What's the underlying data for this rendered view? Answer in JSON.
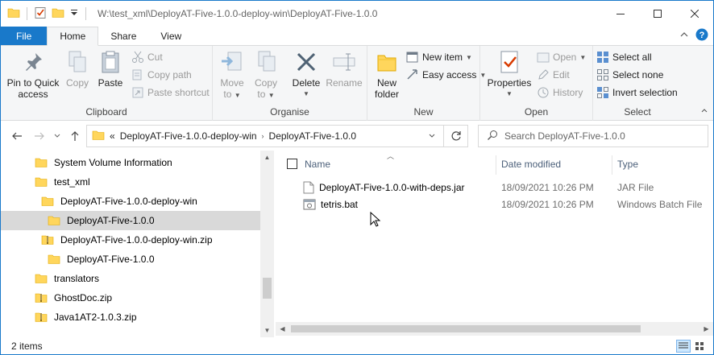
{
  "window": {
    "title": "W:\\test_xml\\DeployAT-Five-1.0.0-deploy-win\\DeployAT-Five-1.0.0"
  },
  "tabs": [
    "File",
    "Home",
    "Share",
    "View"
  ],
  "ribbon": {
    "clipboard": {
      "label": "Clipboard",
      "pin_line1": "Pin to Quick",
      "pin_line2": "access",
      "copy": "Copy",
      "paste": "Paste",
      "cut": "Cut",
      "copy_path": "Copy path",
      "paste_shortcut": "Paste shortcut"
    },
    "organise": {
      "label": "Organise",
      "move_to_1": "Move",
      "move_to_2": "to",
      "copy_to_1": "Copy",
      "copy_to_2": "to",
      "delete": "Delete",
      "rename": "Rename"
    },
    "new": {
      "label": "New",
      "new_folder_1": "New",
      "new_folder_2": "folder",
      "new_item": "New item",
      "easy_access": "Easy access"
    },
    "open": {
      "label": "Open",
      "properties": "Properties",
      "open": "Open",
      "edit": "Edit",
      "history": "History"
    },
    "select": {
      "label": "Select",
      "select_all": "Select all",
      "select_none": "Select none",
      "invert": "Invert selection"
    }
  },
  "address": {
    "overflow": "«",
    "crumbs": [
      "DeployAT-Five-1.0.0-deploy-win",
      "DeployAT-Five-1.0.0"
    ],
    "search_placeholder": "Search DeployAT-Five-1.0.0"
  },
  "nav_tree": [
    {
      "label": "System Volume Information",
      "icon": "folder",
      "indent": 0
    },
    {
      "label": "test_xml",
      "icon": "folder",
      "indent": 0
    },
    {
      "label": "DeployAT-Five-1.0.0-deploy-win",
      "icon": "folder",
      "indent": 1
    },
    {
      "label": "DeployAT-Five-1.0.0",
      "icon": "folder",
      "indent": 2,
      "selected": true
    },
    {
      "label": "DeployAT-Five-1.0.0-deploy-win.zip",
      "icon": "zip",
      "indent": 1
    },
    {
      "label": "DeployAT-Five-1.0.0",
      "icon": "folder",
      "indent": 2
    },
    {
      "label": "translators",
      "icon": "folder",
      "indent": 0
    },
    {
      "label": "GhostDoc.zip",
      "icon": "zip",
      "indent": 0
    },
    {
      "label": "Java1AT2-1.0.3.zip",
      "icon": "zip",
      "indent": 0
    }
  ],
  "columns": {
    "name": "Name",
    "date": "Date modified",
    "type": "Type"
  },
  "files": [
    {
      "name": "DeployAT-Five-1.0.0-with-deps.jar",
      "date": "18/09/2021 10:26 PM",
      "type": "JAR File",
      "icon": "file-icon"
    },
    {
      "name": "tetris.bat",
      "date": "18/09/2021 10:26 PM",
      "type": "Windows Batch File",
      "icon": "batch-file-icon"
    }
  ],
  "status": {
    "count": "2 items"
  },
  "colors": {
    "accent": "#1979ca",
    "folder": "#ffd65c",
    "selection": "#d9d9d9"
  }
}
